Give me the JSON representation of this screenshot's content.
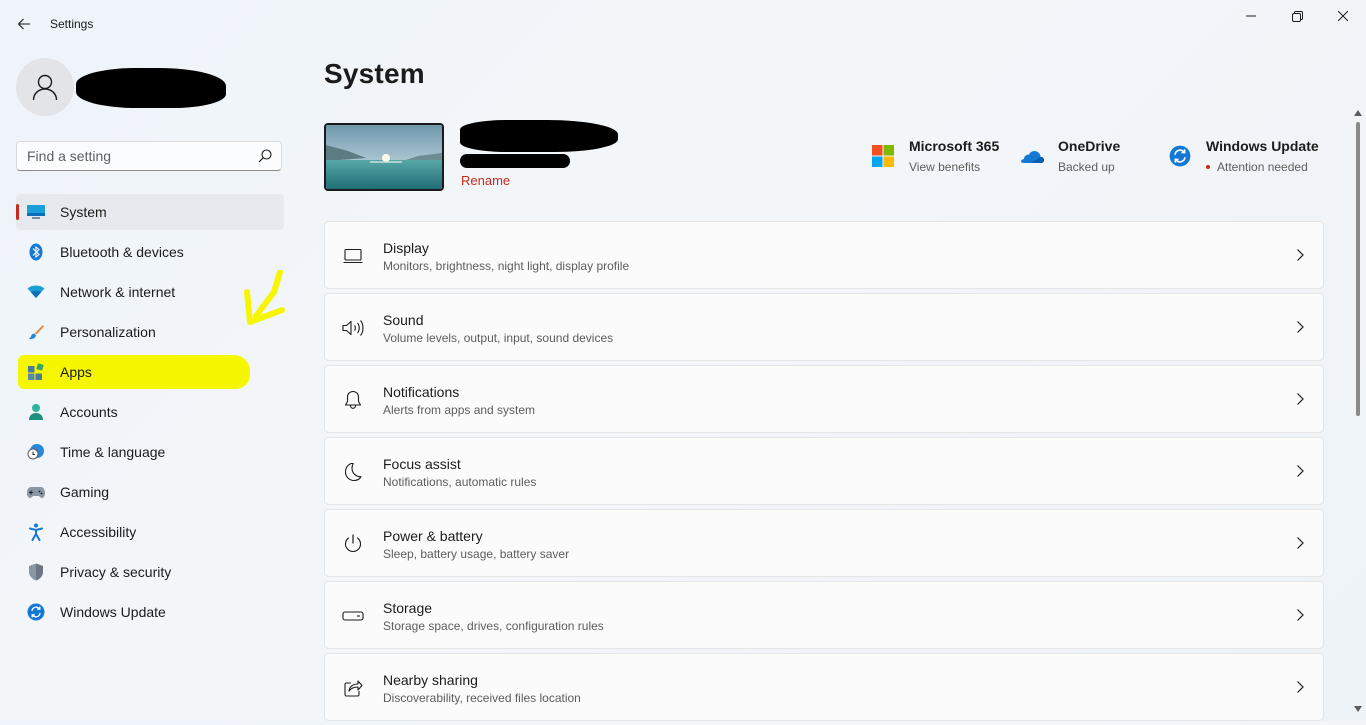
{
  "window": {
    "title": "Settings"
  },
  "search": {
    "placeholder": "Find a setting"
  },
  "sidebar": {
    "items": [
      {
        "label": "System",
        "icon": "system-icon",
        "selected": true
      },
      {
        "label": "Bluetooth & devices",
        "icon": "bluetooth-icon"
      },
      {
        "label": "Network & internet",
        "icon": "wifi-icon"
      },
      {
        "label": "Personalization",
        "icon": "brush-icon"
      },
      {
        "label": "Apps",
        "icon": "apps-icon",
        "highlighted": true
      },
      {
        "label": "Accounts",
        "icon": "accounts-icon"
      },
      {
        "label": "Time & language",
        "icon": "clock-globe-icon"
      },
      {
        "label": "Gaming",
        "icon": "gamepad-icon"
      },
      {
        "label": "Accessibility",
        "icon": "accessibility-icon"
      },
      {
        "label": "Privacy & security",
        "icon": "shield-icon"
      },
      {
        "label": "Windows Update",
        "icon": "update-icon"
      }
    ]
  },
  "main": {
    "title": "System",
    "rename_label": "Rename",
    "quick_links": [
      {
        "title": "Microsoft 365",
        "subtitle": "View benefits",
        "icon": "microsoft-365-icon"
      },
      {
        "title": "OneDrive",
        "subtitle": "Backed up",
        "icon": "onedrive-icon"
      },
      {
        "title": "Windows Update",
        "subtitle": "Attention needed",
        "icon": "windows-update-icon",
        "status": "attention"
      }
    ],
    "settings": [
      {
        "title": "Display",
        "subtitle": "Monitors, brightness, night light, display profile",
        "icon": "display-icon"
      },
      {
        "title": "Sound",
        "subtitle": "Volume levels, output, input, sound devices",
        "icon": "speaker-icon"
      },
      {
        "title": "Notifications",
        "subtitle": "Alerts from apps and system",
        "icon": "bell-icon"
      },
      {
        "title": "Focus assist",
        "subtitle": "Notifications, automatic rules",
        "icon": "moon-icon"
      },
      {
        "title": "Power & battery",
        "subtitle": "Sleep, battery usage, battery saver",
        "icon": "power-icon"
      },
      {
        "title": "Storage",
        "subtitle": "Storage space, drives, configuration rules",
        "icon": "storage-icon"
      },
      {
        "title": "Nearby sharing",
        "subtitle": "Discoverability, received files location",
        "icon": "share-icon"
      }
    ]
  },
  "colors": {
    "accent": "#c42b1c",
    "highlight": "#f6f600",
    "windows_blue": "#0067c0"
  }
}
